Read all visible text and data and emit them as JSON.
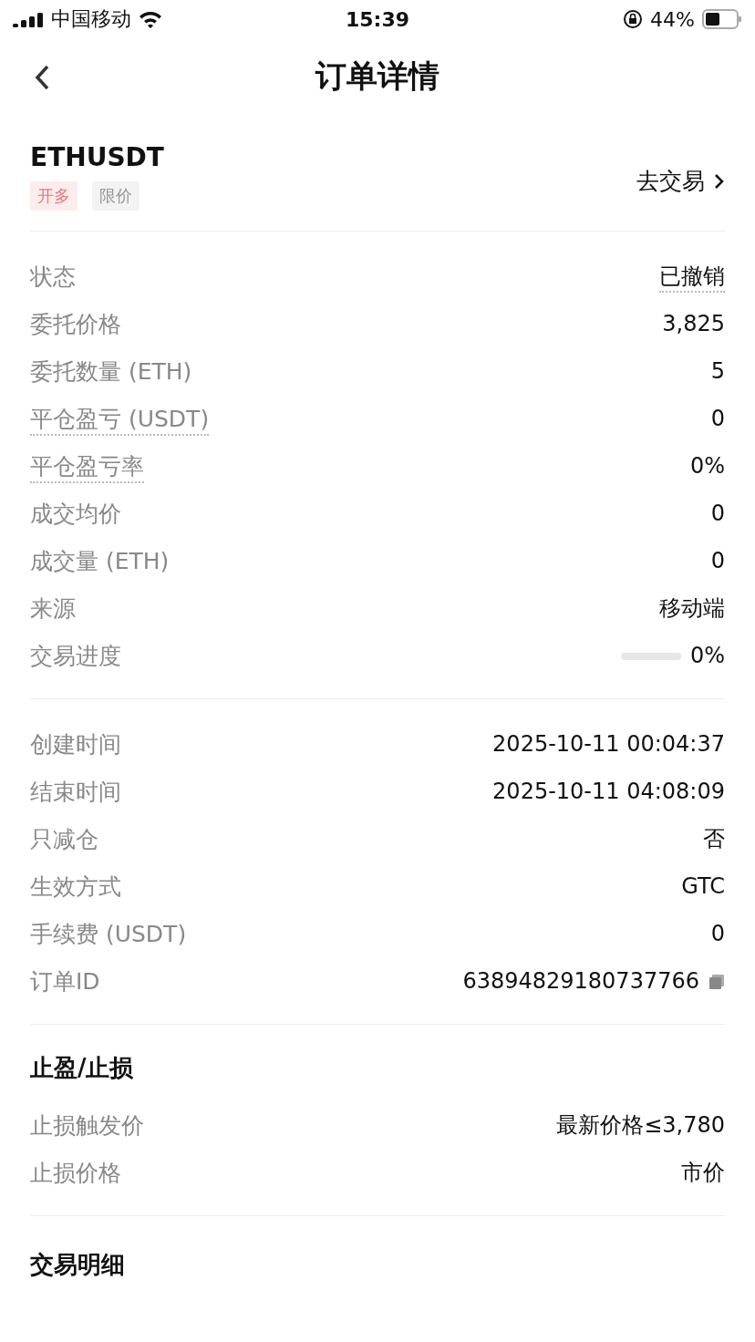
{
  "status_bar": {
    "carrier": "中国移动",
    "time": "15:39",
    "battery": "44%"
  },
  "nav": {
    "title": "订单详情"
  },
  "symbol": {
    "name": "ETHUSDT",
    "tags": [
      {
        "label": "开多",
        "kind": "side"
      },
      {
        "label": "限价",
        "kind": "plain"
      }
    ],
    "trade_link": "去交易"
  },
  "sections": [
    {
      "rows": [
        {
          "kind": "text",
          "label": "状态",
          "value": "已撤销",
          "label_tip": false,
          "value_tip": true
        },
        {
          "kind": "text",
          "label": "委托价格",
          "value": "3,825",
          "label_tip": false,
          "value_tip": false
        },
        {
          "kind": "text",
          "label": "委托数量 (ETH)",
          "value": "5",
          "label_tip": false,
          "value_tip": false
        },
        {
          "kind": "text",
          "label": "平仓盈亏 (USDT)",
          "value": "0",
          "label_tip": true,
          "value_tip": false
        },
        {
          "kind": "text",
          "label": "平仓盈亏率",
          "value": "0%",
          "label_tip": true,
          "value_tip": false
        },
        {
          "kind": "text",
          "label": "成交均价",
          "value": "0",
          "label_tip": false,
          "value_tip": false
        },
        {
          "kind": "text",
          "label": "成交量 (ETH)",
          "value": "0",
          "label_tip": false,
          "value_tip": false
        },
        {
          "kind": "text",
          "label": "来源",
          "value": "移动端",
          "label_tip": false,
          "value_tip": false
        },
        {
          "kind": "progress",
          "label": "交易进度",
          "value": "0%",
          "level": 0,
          "label_tip": false,
          "value_tip": false
        }
      ]
    },
    {
      "rows": [
        {
          "kind": "text",
          "label": "创建时间",
          "value": "2025-10-11 00:04:37",
          "label_tip": false,
          "value_tip": false
        },
        {
          "kind": "text",
          "label": "结束时间",
          "value": "2025-10-11 04:08:09",
          "label_tip": false,
          "value_tip": false
        },
        {
          "kind": "text",
          "label": "只减仓",
          "value": "否",
          "label_tip": false,
          "value_tip": false
        },
        {
          "kind": "text",
          "label": "生效方式",
          "value": "GTC",
          "label_tip": false,
          "value_tip": false
        },
        {
          "kind": "text",
          "label": "手续费 (USDT)",
          "value": "0",
          "label_tip": false,
          "value_tip": false
        },
        {
          "kind": "copy",
          "label": "订单ID",
          "value": "63894829180737766",
          "label_tip": false,
          "value_tip": false
        }
      ]
    },
    {
      "title": "止盈/止损",
      "rows": [
        {
          "kind": "text",
          "label": "止损触发价",
          "value": "最新价格≤3,780",
          "label_tip": false,
          "value_tip": false
        },
        {
          "kind": "text",
          "label": "止损价格",
          "value": "市价",
          "label_tip": false,
          "value_tip": false
        }
      ]
    },
    {
      "title": "交易明细"
    }
  ]
}
